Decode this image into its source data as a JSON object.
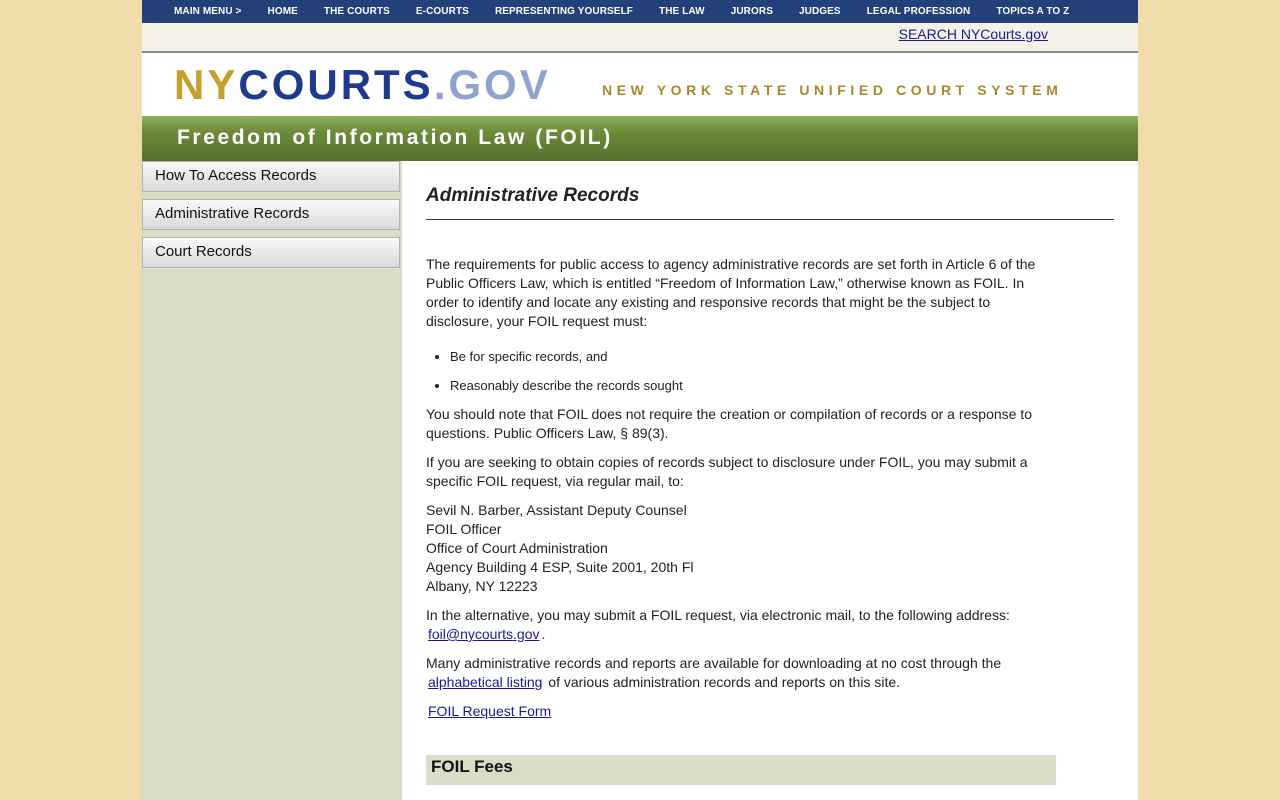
{
  "topnav": [
    "MAIN MENU >",
    "HOME",
    "THE COURTS",
    "E-COURTS",
    "REPRESENTING YOURSELF",
    "THE LAW",
    "JURORS",
    "JUDGES",
    "LEGAL PROFESSION",
    "TOPICS A TO Z"
  ],
  "search_link": "SEARCH NYCourts.gov",
  "logo": {
    "ny": "NY",
    "courts": "COURTS",
    "gov": ".GOV"
  },
  "tagline": "NEW YORK STATE UNIFIED COURT SYSTEM",
  "section_title": "Freedom of Information Law (FOIL)",
  "sidebar": [
    "How To Access Records",
    "Administrative Records",
    "Court Records"
  ],
  "content": {
    "heading": "Administrative Records",
    "intro": "The requirements for public access to agency administrative records are set forth in Article 6 of the Public Officers Law, which is entitled “Freedom of Information Law,” otherwise known as FOIL. In order to identify and locate any existing and responsive records that might be the subject to disclosure, your FOIL request must:",
    "bullets": [
      "Be for specific records, and",
      "Reasonably describe the records sought"
    ],
    "note": "You should note that FOIL does not require the creation or compilation of records or a response to questions. Public Officers Law, § 89(3).",
    "submit": "If you are seeking to obtain copies of records subject to disclosure under FOIL, you may submit a specific FOIL request, via regular mail, to:",
    "address": [
      "Sevil N. Barber, Assistant Deputy Counsel",
      "FOIL Officer",
      "Office of Court Administration",
      "Agency Building 4 ESP, Suite 2001, 20th Fl",
      "Albany, NY 12223"
    ],
    "email_intro": "In the alternative, you may submit a FOIL request, via electronic mail, to the following address:",
    "email": "foil@nycourts.gov",
    "email_end": ".",
    "reports_intro": "Many administrative records and reports are available for downloading at no cost through the",
    "reports_link": "alphabetical listing",
    "reports_end": "of various administration records and reports on this site.",
    "form_link": "FOIL Request Form",
    "fees_heading": "FOIL Fees"
  }
}
